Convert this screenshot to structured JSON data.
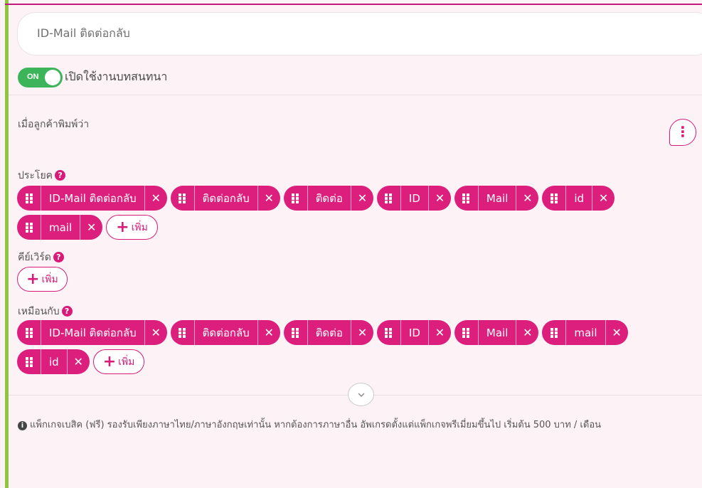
{
  "title_input": {
    "value": "ID-Mail ติดต่อกลับ"
  },
  "toggle": {
    "state_label": "ON",
    "label": "เปิดใช้งานบทสนทนา"
  },
  "section": {
    "label": "เมื่อลูกค้าพิมพ์ว่า"
  },
  "sentences": {
    "label": "ประโยค",
    "chips": [
      "ID-Mail ติดต่อกลับ",
      "ติดต่อกลับ",
      "ติดต่อ",
      "ID",
      "Mail",
      "id",
      "mail"
    ],
    "add_label": "เพิ่ม"
  },
  "keywords": {
    "label": "คีย์เวิร์ด",
    "add_label": "เพิ่ม"
  },
  "similar": {
    "label": "เหมือนกับ",
    "chips": [
      "ID-Mail ติดต่อกลับ",
      "ติดต่อกลับ",
      "ติดต่อ",
      "ID",
      "Mail",
      "mail",
      "id"
    ],
    "add_label": "เพิ่ม"
  },
  "note": {
    "text": "แพ็กเกจเบสิค (ฟรี) รองรับเพียงภาษาไทย/ภาษาอังกฤษเท่านั้น หากต้องการภาษาอื่น อัพเกรดตั้งแต่แพ็กเกจพรีเมี่ยมขึ้นไป เริ่มต้น 500 บาท / เดือน"
  },
  "icons": {
    "help": "question-circle-icon",
    "more": "vertical-dots-icon",
    "drag": "drag-handle-icon",
    "remove": "close-icon",
    "add": "plus-icon",
    "expand": "chevron-down-icon",
    "info": "info-circle-icon"
  },
  "colors": {
    "accent": "#dc1e7c",
    "toggle_on": "#3cb55a",
    "left_bar": "#8dc63f",
    "background": "#fdf2f6"
  }
}
